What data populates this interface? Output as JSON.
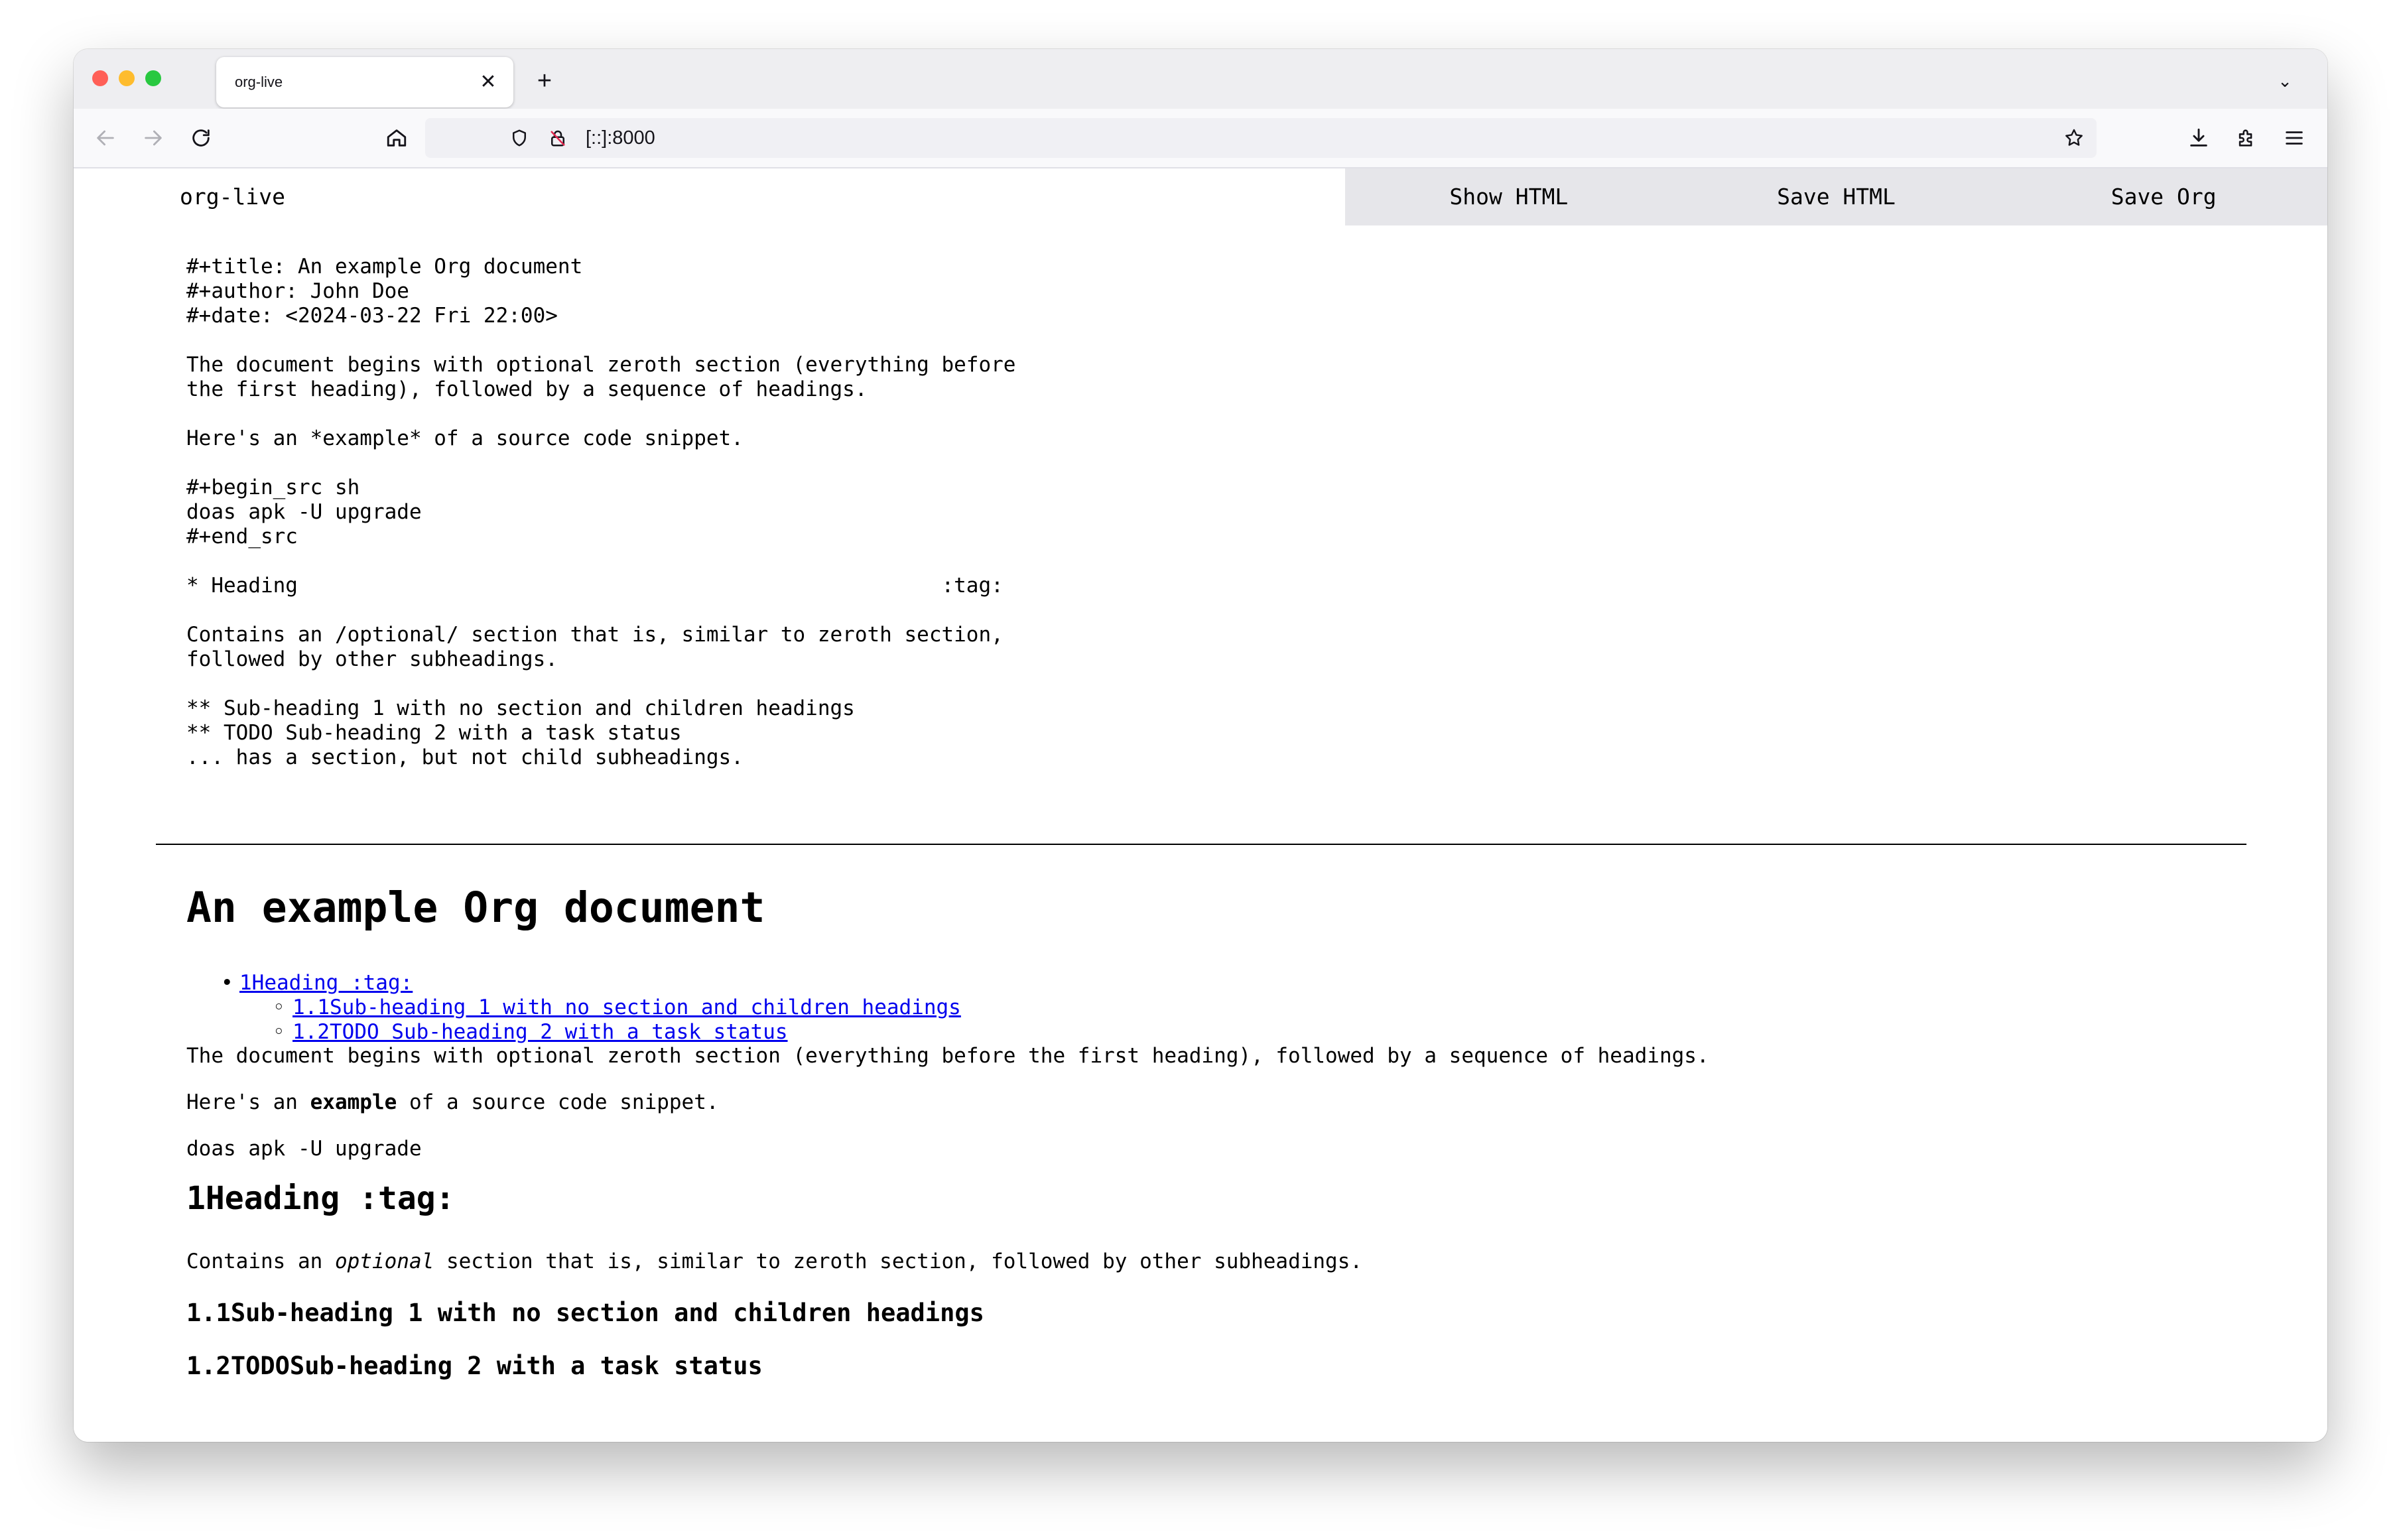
{
  "browser": {
    "tab_title": "org-live",
    "tab_close": "✕",
    "new_tab": "+",
    "list_tabs": "⌄",
    "url": "[::]:8000",
    "traffic_colors": [
      "#ff5f57",
      "#febc2e",
      "#28c840"
    ]
  },
  "app": {
    "title": "org-live",
    "buttons": {
      "show_html": "Show HTML",
      "save_html": "Save HTML",
      "save_org": "Save Org"
    }
  },
  "source": "#+title: An example Org document\n#+author: John Doe\n#+date: <2024-03-22 Fri 22:00>\n\nThe document begins with optional zeroth section (everything before\nthe first heading), followed by a sequence of headings.\n\nHere's an *example* of a source code snippet.\n\n#+begin_src sh\ndoas apk -U upgrade\n#+end_src\n\n* Heading                                                    :tag:\n\nContains an /optional/ section that is, similar to zeroth section,\nfollowed by other subheadings.\n\n** Sub-heading 1 with no section and children headings\n** TODO Sub-heading 2 with a task status\n... has a section, but not child subheadings.",
  "render": {
    "title": "An example Org document",
    "toc": [
      {
        "label": "1Heading :tag:"
      },
      {
        "label": "1.1Sub-heading 1 with no section and children headings"
      },
      {
        "label": "1.2TODO Sub-heading 2 with a task status"
      }
    ],
    "zeroth_paragraph": "The document begins with optional zeroth section (everything before the first heading), followed by a sequence of headings.",
    "example_prefix": "Here's an ",
    "example_bold": "example",
    "example_suffix": " of a source code snippet.",
    "code": "doas apk -U upgrade",
    "heading1": "1Heading :tag:",
    "section_prefix": "Contains an ",
    "section_italic": "optional",
    "section_suffix": " section that is, similar to zeroth section, followed by other subheadings.",
    "heading11": "1.1Sub-heading 1 with no section and children headings",
    "heading12": "1.2TODOSub-heading 2 with a task status"
  }
}
